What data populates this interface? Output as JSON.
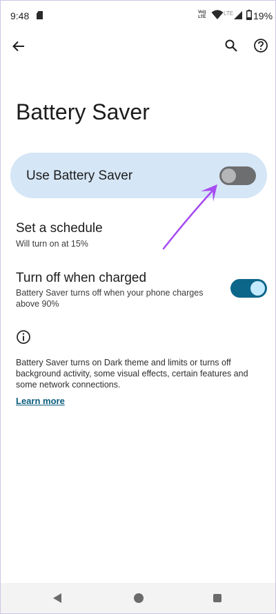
{
  "status_bar": {
    "time": "9:48",
    "volte_line1": "Vo))",
    "volte_line2": "LTE",
    "network_type": "LTE",
    "battery_percent": "19%"
  },
  "toolbar": {
    "back_icon": "arrow-back-icon",
    "search_icon": "search-icon",
    "help_icon": "help-circle-icon"
  },
  "page": {
    "title": "Battery Saver"
  },
  "main_switch": {
    "label": "Use Battery Saver",
    "checked": false
  },
  "settings": {
    "schedule": {
      "title": "Set a schedule",
      "summary": "Will turn on at 15%"
    },
    "turn_off_when_charged": {
      "title": "Turn off when charged",
      "summary": "Battery Saver turns off when your phone charges above 90%",
      "checked": true
    }
  },
  "footer": {
    "info_icon": "info-icon",
    "text": "Battery Saver turns on Dark theme and limits or turns off background activity, some visual effects, certain features and some network connections.",
    "learn_more": "Learn more"
  },
  "annotation": {
    "arrow_color": "#a64cf0"
  },
  "colors": {
    "card_background": "#d5e6f6",
    "toggle_on": "#0b6689",
    "toggle_off": "#6d6e70",
    "link": "#0a5d7d"
  },
  "navigation_bar": {
    "back_icon": "nav-back-icon",
    "home_icon": "nav-home-icon",
    "recents_icon": "nav-recents-icon"
  }
}
